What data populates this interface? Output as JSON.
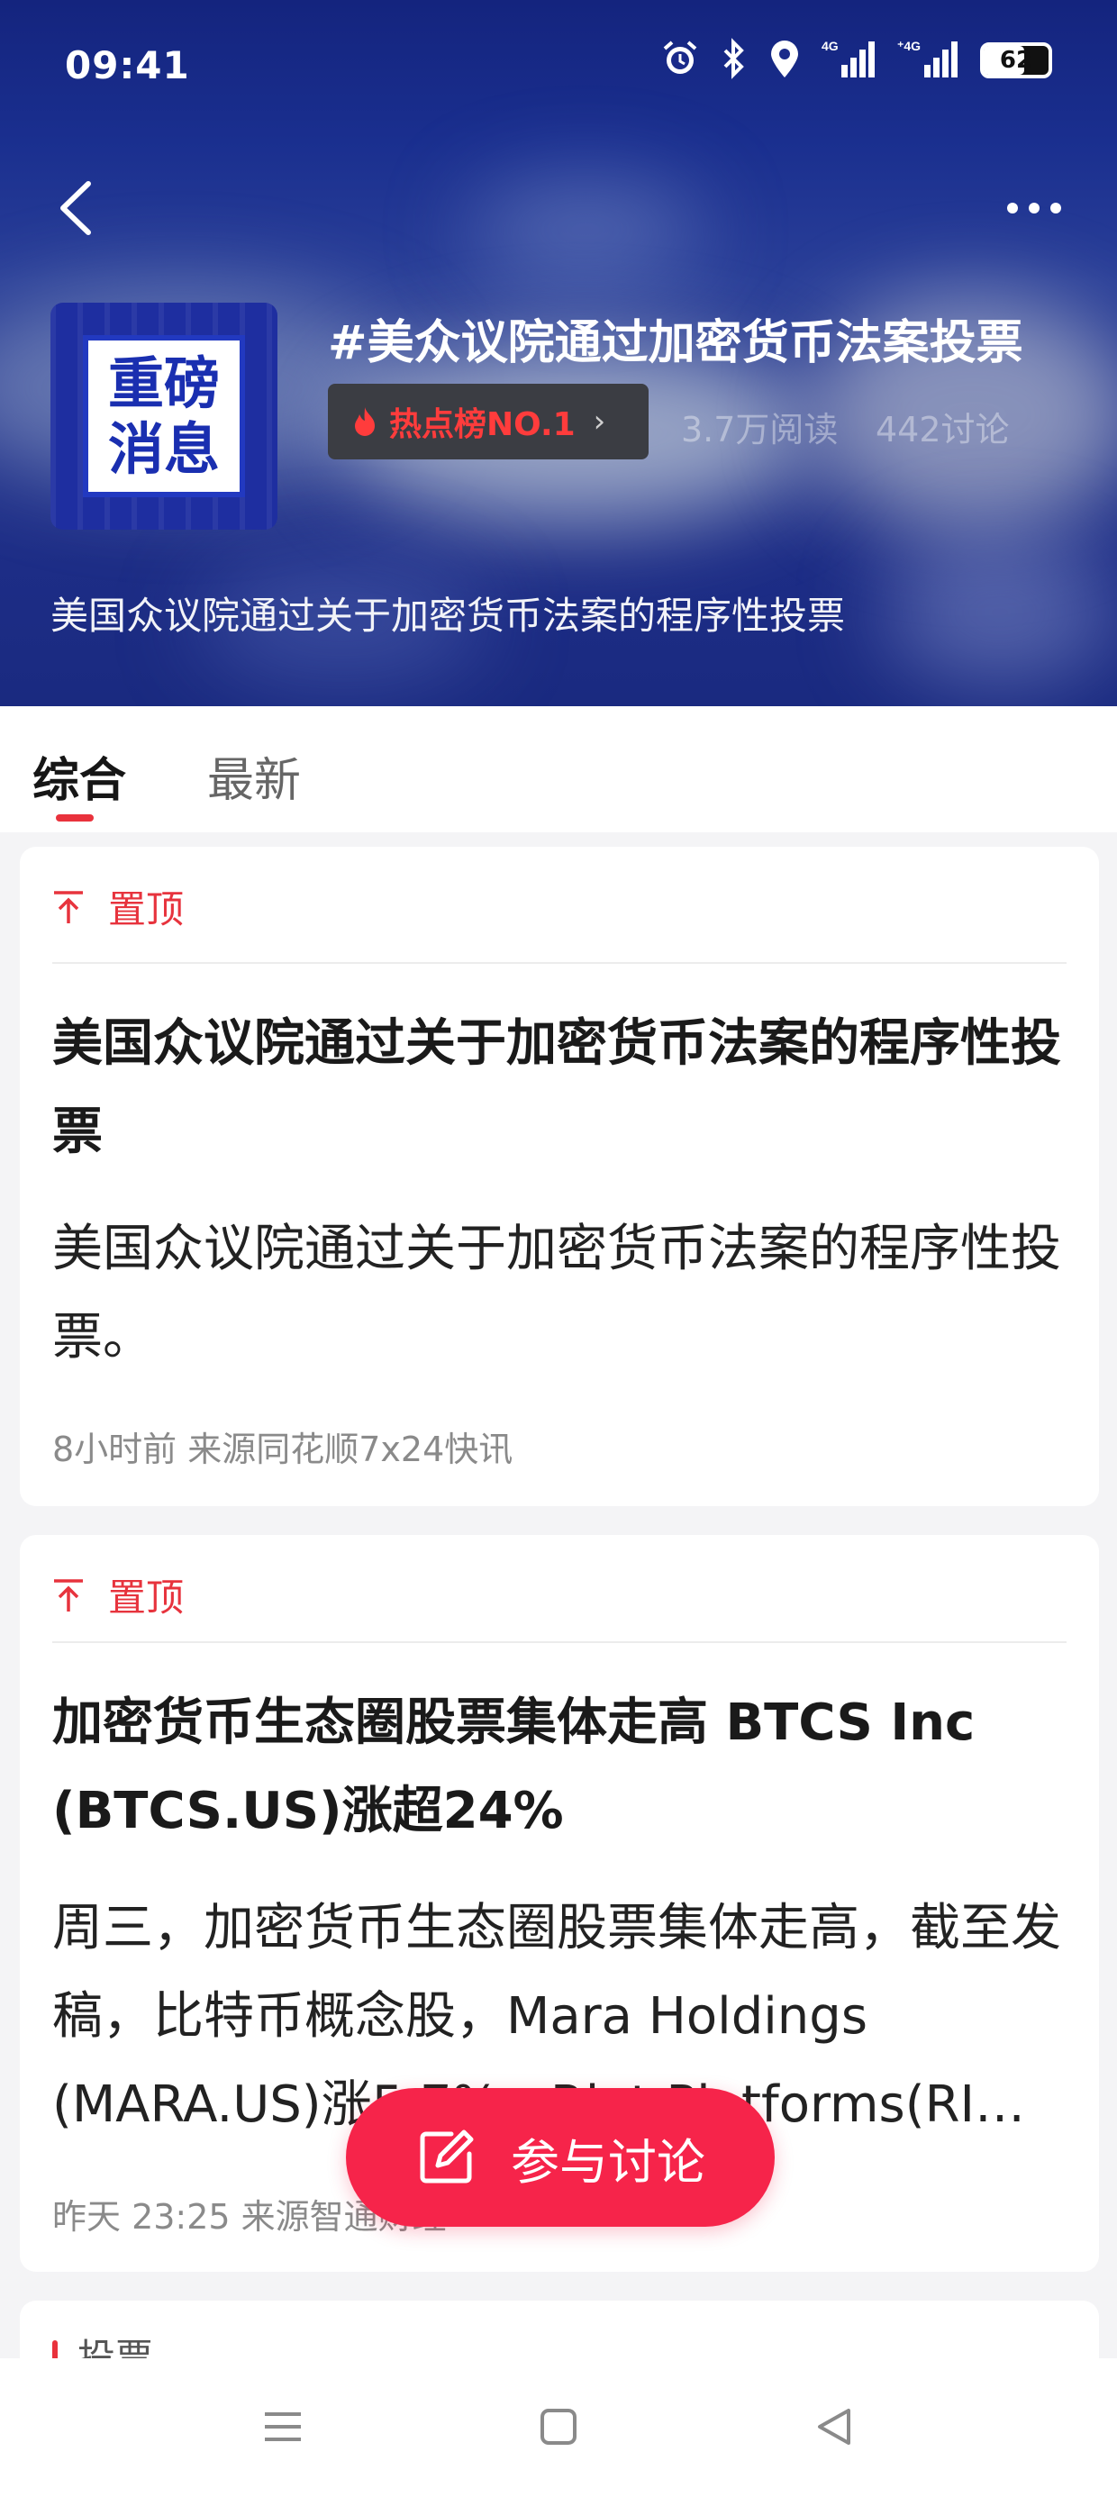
{
  "status_bar": {
    "time": "09:41",
    "icons": [
      "alarm-icon",
      "bluetooth-icon",
      "location-icon",
      "signal-4g-icon",
      "signal-4g-icon"
    ],
    "battery": "62",
    "battery_level": 0.62
  },
  "header": {
    "back_icon": "back-arrow-icon",
    "more_icon": "more-dots-icon",
    "cover_text_line1": "重磅",
    "cover_text_line2": "消息",
    "title": "#美众议院通过加密货币法案投票",
    "hot_badge": "热点榜NO.1",
    "reads": "3.7万阅读",
    "discussions": "442讨论",
    "description": "美国众议院通过关于加密货币法案的程序性投票"
  },
  "tabs": {
    "active": "综合",
    "other": "最新"
  },
  "posts": [
    {
      "pin_label": "置顶",
      "title": "美国众议院通过关于加密货币法案的程序性投票",
      "body": "美国众议院通过关于加密货币法案的程序性投票。",
      "meta": "8小时前 来源同花顺7x24快讯"
    },
    {
      "pin_label": "置顶",
      "title": "加密货币生态圈股票集体走高 BTCS Inc (BTCS.US)涨超24%",
      "body": "周三，加密货币生态圈股票集体走高，截至发稿，比特币概念股，Mara Holdings (MARA.US)涨5.7%，Riot Platforms(RI…",
      "meta": "昨天 23:25 来源智通财经"
    }
  ],
  "card3": {
    "label": "投票"
  },
  "join_button": {
    "label": "参与讨论"
  },
  "navbar": {
    "icons": [
      "menu-icon",
      "home-icon",
      "back-icon"
    ]
  },
  "colors": {
    "accent": "#e9323c",
    "header_bg": "#1a2f8f",
    "button": "#f6244a"
  }
}
